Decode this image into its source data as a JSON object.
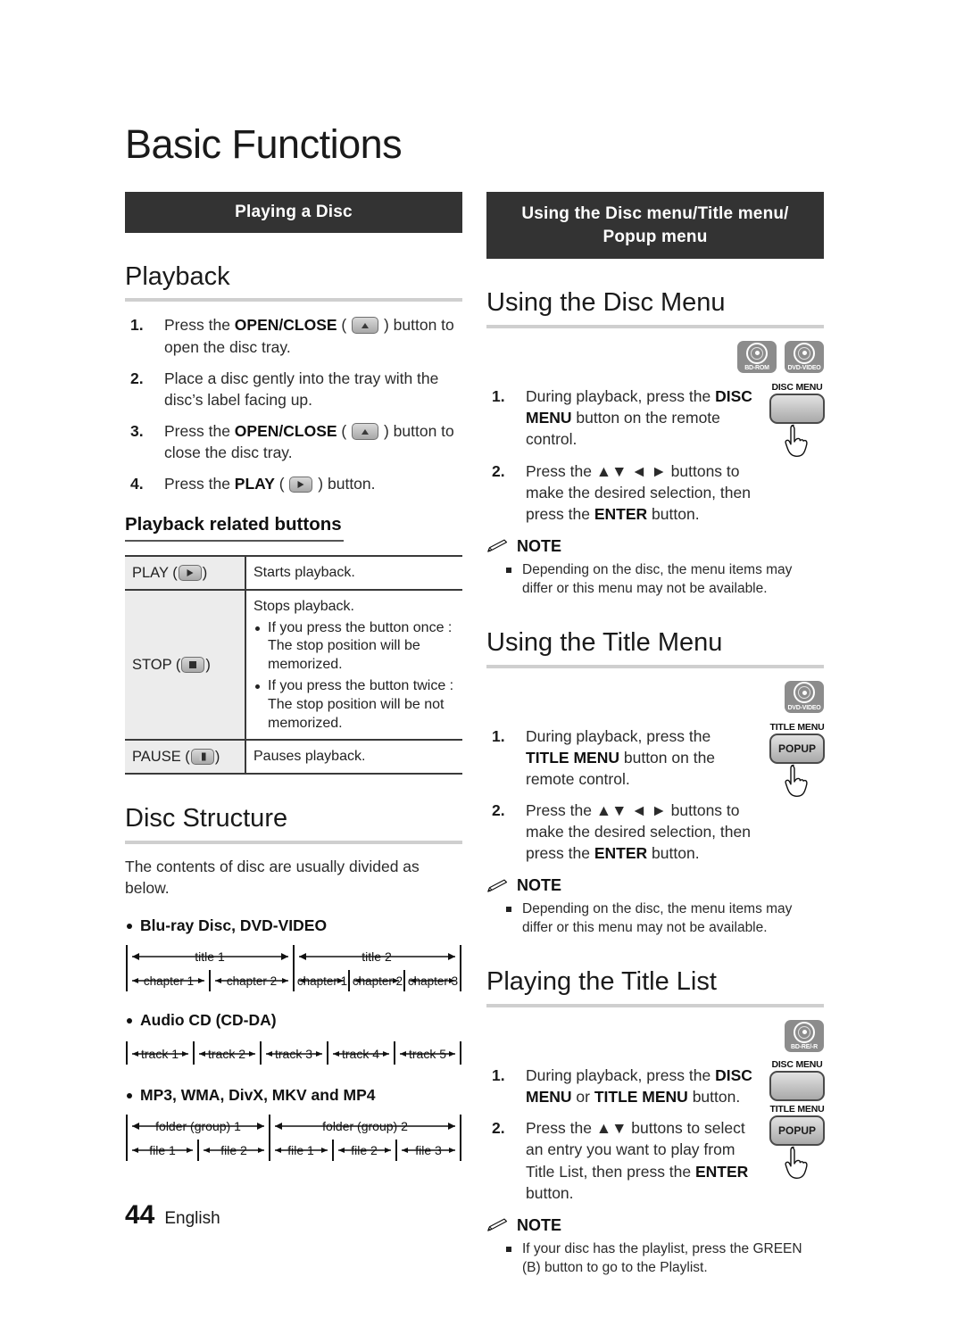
{
  "page": {
    "title": "Basic Functions",
    "footer_page_number": "44",
    "footer_language": "English"
  },
  "left": {
    "banner": "Playing a Disc",
    "playback": {
      "heading": "Playback",
      "steps": [
        {
          "num": "1.",
          "pre": "Press the ",
          "bold": "OPEN/CLOSE",
          "mid": " ( ",
          "icon": "eject-key-icon",
          "post": " ) button to open the disc tray."
        },
        {
          "num": "2.",
          "pre": "Place a disc gently into the tray with the disc’s label facing up.",
          "bold": "",
          "mid": "",
          "icon": "",
          "post": ""
        },
        {
          "num": "3.",
          "pre": "Press the ",
          "bold": "OPEN/CLOSE",
          "mid": " ( ",
          "icon": "eject-key-icon",
          "post": " ) button to close the disc tray."
        },
        {
          "num": "4.",
          "pre": "Press the ",
          "bold": "PLAY",
          "mid": " ( ",
          "icon": "play-key-icon",
          "post": " ) button."
        }
      ]
    },
    "buttons_table": {
      "heading": "Playback related buttons",
      "rows": [
        {
          "key_label": "PLAY",
          "key_icon": "play-key-icon",
          "desc": "Starts playback.",
          "sub": []
        },
        {
          "key_label": "STOP",
          "key_icon": "stop-key-icon",
          "desc": "Stops playback.",
          "sub": [
            "If you press the button once : The stop position will be memorized.",
            "If you press the button twice : The stop position will be not memorized."
          ]
        },
        {
          "key_label": "PAUSE",
          "key_icon": "pause-key-icon",
          "desc": "Pauses playback.",
          "sub": []
        }
      ]
    },
    "disc_structure": {
      "heading": "Disc Structure",
      "lead": "The contents of disc are usually divided as below.",
      "groups": [
        {
          "label": "Blu-ray Disc, DVD-VIDEO",
          "top_row": [
            "title 1",
            "title 2"
          ],
          "top_spans": [
            2,
            3
          ],
          "bottom_row": [
            "chapter 1",
            "chapter 2",
            "chapter 1",
            "chapter 2",
            "chapter 3"
          ]
        },
        {
          "label": "Audio CD (CD-DA)",
          "top_row": [],
          "top_spans": [],
          "bottom_row": [
            "track 1",
            "track 2",
            "track 3",
            "track 4",
            "track 5"
          ]
        },
        {
          "label": "MP3, WMA, DivX, MKV and MP4",
          "top_row": [
            "folder (group) 1",
            "folder (group) 2"
          ],
          "top_spans": [
            2,
            3
          ],
          "bottom_row": [
            "file 1",
            "file 2",
            "file 1",
            "file 2",
            "file 3"
          ]
        }
      ]
    }
  },
  "right": {
    "banner_line1": "Using the Disc menu/Title menu/",
    "banner_line2": "Popup menu",
    "sections": [
      {
        "heading": "Using the Disc Menu",
        "badges": [
          {
            "name": "bd-rom-badge",
            "label": "BD-ROM"
          },
          {
            "name": "dvd-video-badge",
            "label": "DVD-VIDEO"
          }
        ],
        "remote_keys": [
          {
            "name": "disc-menu-remote-key",
            "label": "DISC MENU",
            "face": ""
          }
        ],
        "steps": [
          {
            "num": "1.",
            "parts": [
              "During playback, press the ",
              "DISC MENU",
              " button on the remote control."
            ]
          },
          {
            "num": "2.",
            "parts": [
              "Press the ▲▼ ◄ ► buttons to make the desired selection, then press the ",
              "ENTER",
              " button."
            ]
          }
        ],
        "note": {
          "label": "NOTE",
          "items": [
            "Depending on the disc, the menu items may differ or this menu may not be available."
          ]
        }
      },
      {
        "heading": "Using the Title Menu",
        "badges": [
          {
            "name": "dvd-video-badge",
            "label": "DVD-VIDEO"
          }
        ],
        "remote_keys": [
          {
            "name": "title-menu-popup-remote-key",
            "label": "TITLE MENU",
            "face": "POPUP"
          }
        ],
        "steps": [
          {
            "num": "1.",
            "parts": [
              "During playback, press the ",
              "TITLE MENU",
              " button on the remote control."
            ]
          },
          {
            "num": "2.",
            "parts": [
              "Press the ▲▼ ◄ ► buttons to make the desired selection, then press the ",
              "ENTER",
              " button."
            ]
          }
        ],
        "note": {
          "label": "NOTE",
          "items": [
            "Depending on the disc, the menu items may differ or this menu may not be available."
          ]
        }
      },
      {
        "heading": "Playing the Title List",
        "badges": [
          {
            "name": "bd-re-r-badge",
            "label": "BD-RE/-R"
          }
        ],
        "remote_keys": [
          {
            "name": "disc-menu-remote-key",
            "label": "DISC MENU",
            "face": ""
          },
          {
            "name": "title-menu-popup-remote-key",
            "label": "TITLE MENU",
            "face": "POPUP"
          }
        ],
        "steps": [
          {
            "num": "1.",
            "parts": [
              "During playback, press the ",
              "DISC MENU",
              " or ",
              "TITLE MENU",
              " button."
            ]
          },
          {
            "num": "2.",
            "parts": [
              "Press the ▲▼ buttons to select an entry you want to play from Title List, then press the ",
              "ENTER",
              " button."
            ]
          }
        ],
        "note": {
          "label": "NOTE",
          "items": [
            "If your disc has the playlist, press the GREEN (B) button to go to the Playlist."
          ]
        }
      }
    ]
  }
}
